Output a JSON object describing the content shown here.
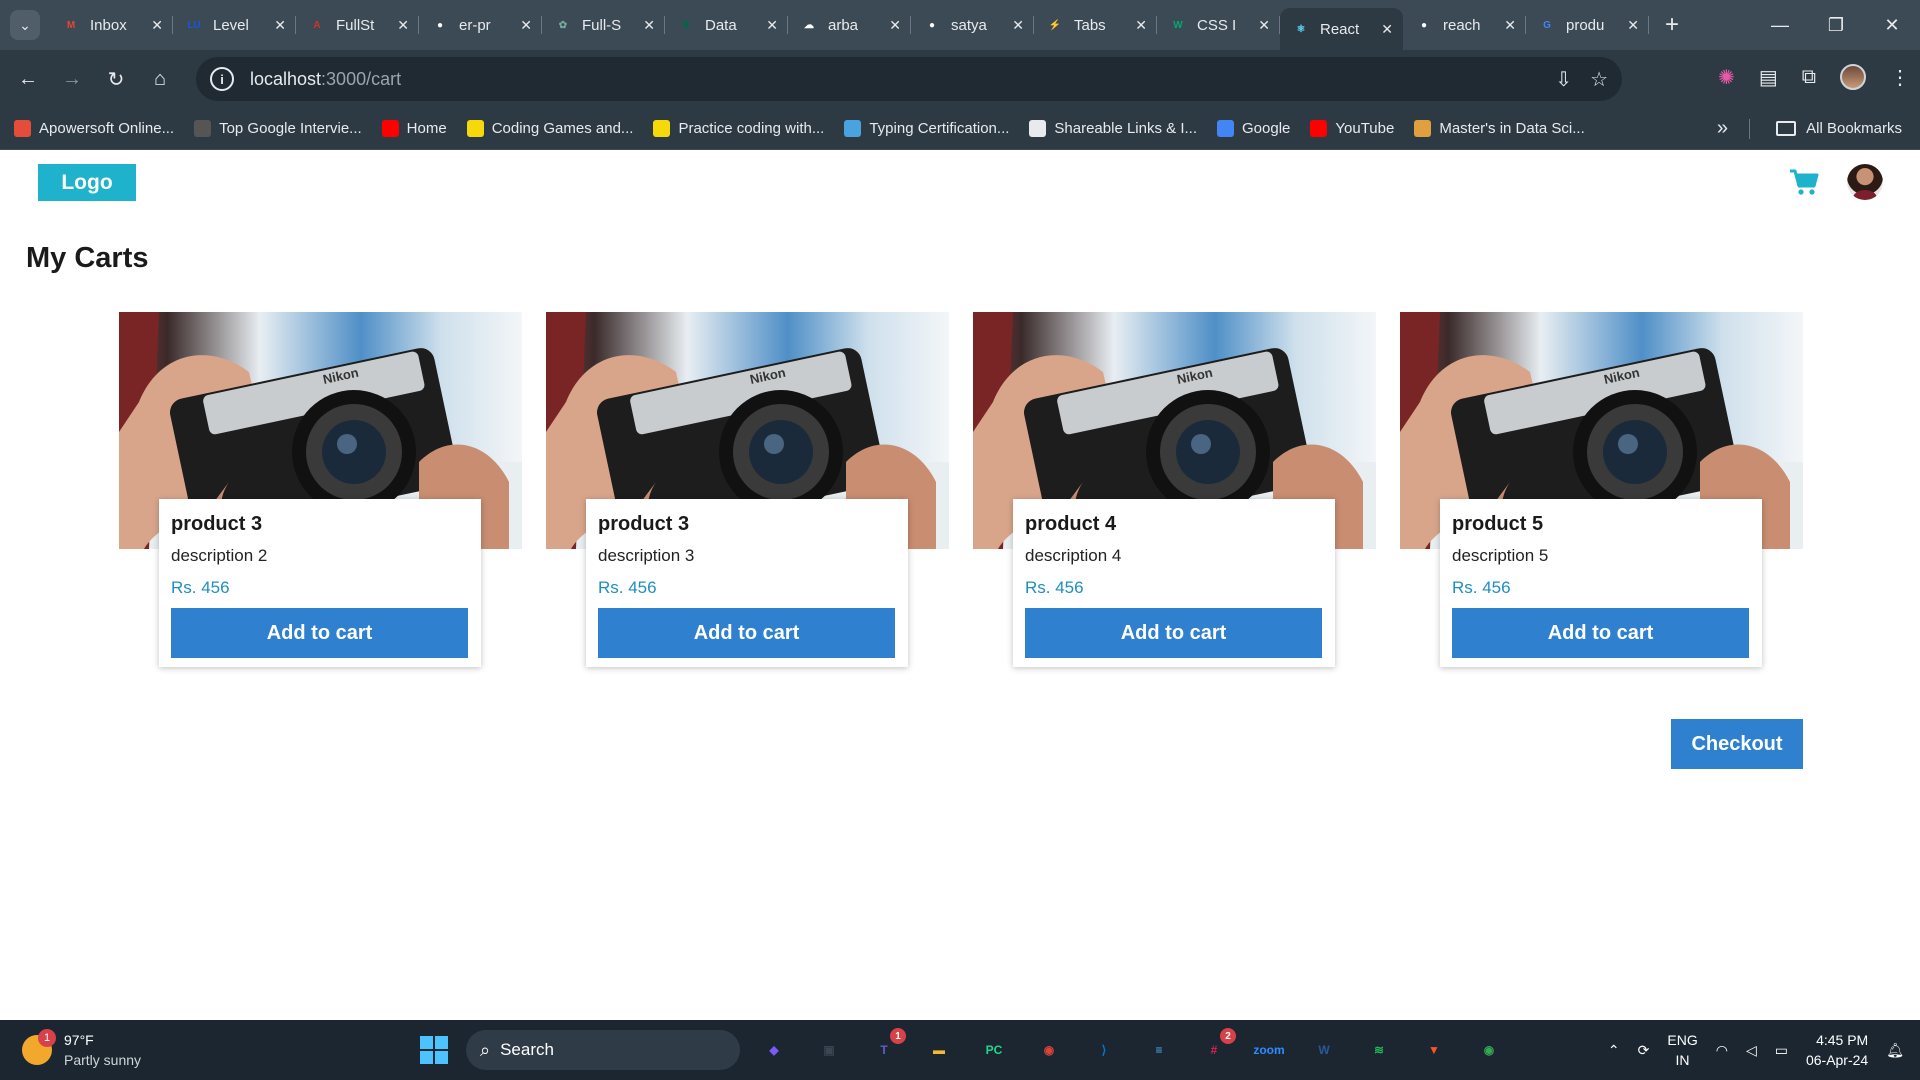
{
  "browser": {
    "tabs": [
      {
        "title": "Inbox",
        "icon": "gmail-icon",
        "color": "#ea4335",
        "glyph": "M"
      },
      {
        "title": "Level",
        "icon": "lu-icon",
        "color": "#1a56db",
        "glyph": "LU"
      },
      {
        "title": "FullSt",
        "icon": "pdf-icon",
        "color": "#d93025",
        "glyph": "A"
      },
      {
        "title": "er-pr",
        "icon": "github-icon",
        "color": "#ffffff",
        "glyph": "●"
      },
      {
        "title": "Full-S",
        "icon": "chatgpt-icon",
        "color": "#74aa9c",
        "glyph": "✿"
      },
      {
        "title": "Data",
        "icon": "mongodb-icon",
        "color": "#00684a",
        "glyph": "❦"
      },
      {
        "title": "arba",
        "icon": "cloud-check-icon",
        "color": "#ffffff",
        "glyph": "☁"
      },
      {
        "title": "satya",
        "icon": "github-icon",
        "color": "#ffffff",
        "glyph": "●"
      },
      {
        "title": "Tabs",
        "icon": "bolt-icon",
        "color": "#38bdb0",
        "glyph": "⚡"
      },
      {
        "title": "CSS I",
        "icon": "w3schools-icon",
        "color": "#04aa6d",
        "glyph": "W"
      },
      {
        "title": "React",
        "icon": "react-icon",
        "color": "#61dafb",
        "glyph": "⚛"
      },
      {
        "title": "reach",
        "icon": "github-icon",
        "color": "#ffffff",
        "glyph": "●"
      },
      {
        "title": "produ",
        "icon": "google-icon",
        "color": "#4285f4",
        "glyph": "G"
      }
    ],
    "url_host": "localhost",
    "url_path": ":3000/cart",
    "bookmarks": [
      {
        "label": "Apowersoft Online...",
        "color": "#e44d3a"
      },
      {
        "label": "Top Google Intervie...",
        "color": "#555555"
      },
      {
        "label": "Home",
        "color": "#ff0000"
      },
      {
        "label": "Coding Games and...",
        "color": "#f5d90a"
      },
      {
        "label": "Practice coding with...",
        "color": "#f5d90a"
      },
      {
        "label": "Typing Certification...",
        "color": "#4aa3df"
      },
      {
        "label": "Shareable Links & I...",
        "color": "#e8eaed"
      },
      {
        "label": "Google",
        "color": "#4285f4"
      },
      {
        "label": "YouTube",
        "color": "#ff0000"
      },
      {
        "label": "Master's in Data Sci...",
        "color": "#e0a040"
      }
    ],
    "all_bookmarks": "All Bookmarks"
  },
  "app": {
    "logo": "Logo",
    "page_title": "My Carts",
    "accent_color": "#1eb2cc",
    "button_color": "#2f80cf",
    "products": [
      {
        "name": "product 3",
        "description": "description 2",
        "price": "Rs. 456",
        "button": "Add to cart"
      },
      {
        "name": "product 3",
        "description": "description 3",
        "price": "Rs. 456",
        "button": "Add to cart"
      },
      {
        "name": "product 4",
        "description": "description 4",
        "price": "Rs. 456",
        "button": "Add to cart"
      },
      {
        "name": "product 5",
        "description": "description 5",
        "price": "Rs. 456",
        "button": "Add to cart"
      }
    ],
    "checkout": "Checkout"
  },
  "taskbar": {
    "temperature": "97°F",
    "condition": "Partly sunny",
    "weather_badge": "1",
    "search": "Search",
    "apps": [
      {
        "name": "copilot-icon",
        "glyph": "◆",
        "color": "#7a5af8",
        "badge": ""
      },
      {
        "name": "task-view-icon",
        "glyph": "▣",
        "color": "#3a4652",
        "badge": ""
      },
      {
        "name": "teams-icon",
        "glyph": "T",
        "color": "#5b5fc7",
        "badge": "1"
      },
      {
        "name": "file-explorer-icon",
        "glyph": "▬",
        "color": "#f3b73a",
        "badge": ""
      },
      {
        "name": "pycharm-icon",
        "glyph": "PC",
        "color": "#21d789",
        "badge": ""
      },
      {
        "name": "chrome-icon",
        "glyph": "◉",
        "color": "#db4437",
        "badge": ""
      },
      {
        "name": "vscode-icon",
        "glyph": "⟩",
        "color": "#0078d4",
        "badge": ""
      },
      {
        "name": "notepad-icon",
        "glyph": "≡",
        "color": "#4ab0e8",
        "badge": ""
      },
      {
        "name": "slack-icon",
        "glyph": "#",
        "color": "#e01e5a",
        "badge": "2"
      },
      {
        "name": "zoom-icon",
        "glyph": "zoom",
        "color": "#2d8cff",
        "badge": ""
      },
      {
        "name": "word-icon",
        "glyph": "W",
        "color": "#2b579a",
        "badge": ""
      },
      {
        "name": "spotify-icon",
        "glyph": "≋",
        "color": "#1db954",
        "badge": ""
      },
      {
        "name": "brave-icon",
        "glyph": "▼",
        "color": "#fb542b",
        "badge": ""
      },
      {
        "name": "chrome-profile-icon",
        "glyph": "◉",
        "color": "#34a853",
        "badge": ""
      }
    ],
    "lang_top": "ENG",
    "lang_bottom": "IN",
    "time": "4:45 PM",
    "date": "06-Apr-24"
  }
}
